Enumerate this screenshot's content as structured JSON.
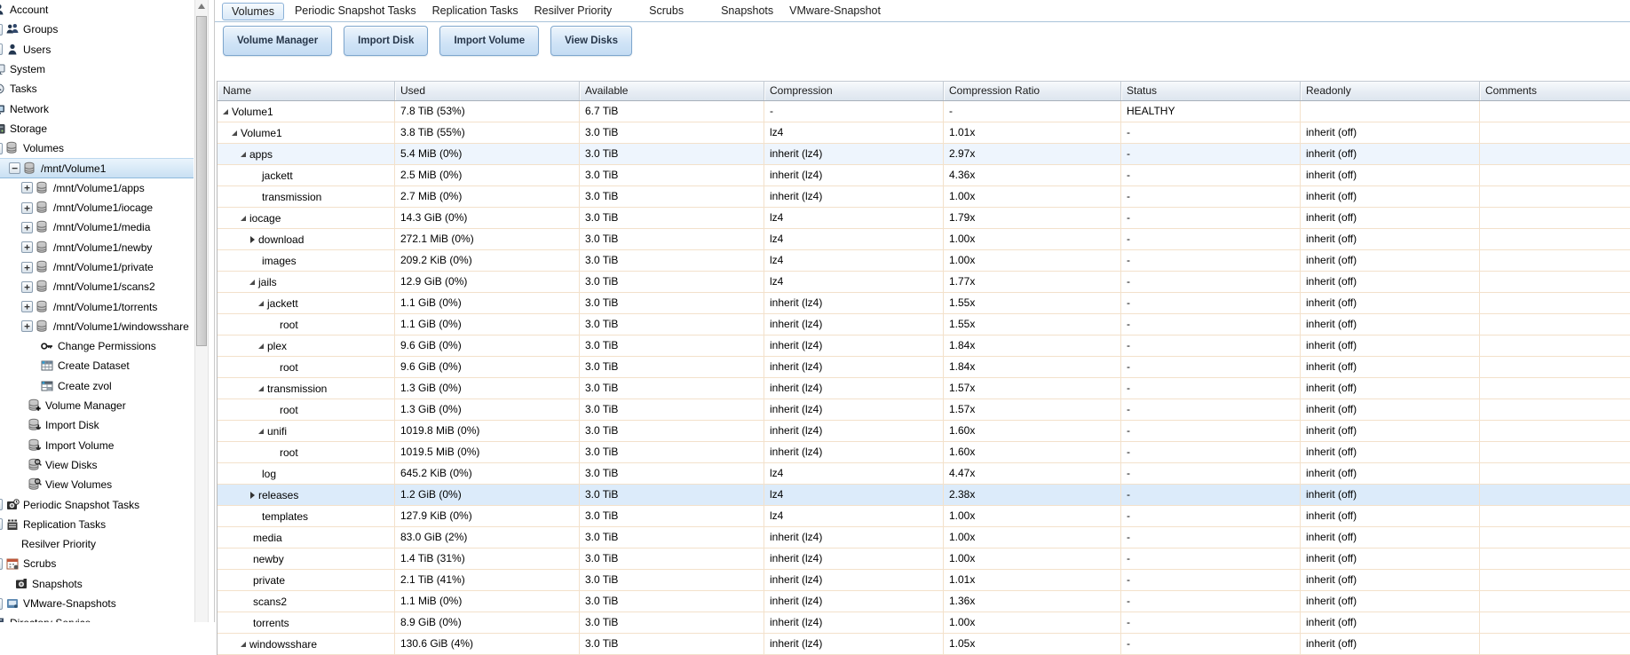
{
  "colors": {
    "selection_blue": "#dcebfa",
    "hover_blue": "#eef5fd",
    "row_border_tan": "#f3e1cb",
    "button_face": "#cfe3f6",
    "button_border": "#7ea6cd",
    "tab_border": "#8cb2d8",
    "sidebar_selection": "#c9e0f3",
    "healthy_status": "#000000"
  },
  "tabs": {
    "active": "Volumes",
    "items": [
      "Volumes",
      "Periodic Snapshot Tasks",
      "Replication Tasks",
      "Resilver Priority",
      "Scrubs",
      "Snapshots",
      "VMware-Snapshot"
    ]
  },
  "toolbar": {
    "buttons": [
      "Volume Manager",
      "Import Disk",
      "Import Volume",
      "View Disks"
    ]
  },
  "sidebar": {
    "items": [
      {
        "label": "Account",
        "icon": "account-icon",
        "pad": 0,
        "exp": "none",
        "cut_icon": true
      },
      {
        "label": "Groups",
        "icon": "groups-icon",
        "pad": 0,
        "exp": "cut"
      },
      {
        "label": "Users",
        "icon": "user-icon",
        "pad": 0,
        "exp": "cut"
      },
      {
        "label": "System",
        "icon": "system-icon",
        "pad": 0,
        "exp": "none",
        "cut_icon": true
      },
      {
        "label": "Tasks",
        "icon": "tasks-icon",
        "pad": 0,
        "exp": "none",
        "cut_icon": true
      },
      {
        "label": "Network",
        "icon": "network-icon",
        "pad": 0,
        "exp": "none",
        "cut_icon": true
      },
      {
        "label": "Storage",
        "icon": "storage-icon",
        "pad": 0,
        "exp": "none",
        "cut_icon": true
      },
      {
        "label": "Volumes",
        "icon": "volume-icon",
        "pad": 0,
        "exp": "cut"
      },
      {
        "label": "/mnt/Volume1",
        "icon": "volume-icon",
        "pad": 10,
        "exp": "minus",
        "selected": true
      },
      {
        "label": "/mnt/Volume1/apps",
        "icon": "volume-icon",
        "pad": 24,
        "exp": "plus"
      },
      {
        "label": "/mnt/Volume1/iocage",
        "icon": "volume-icon",
        "pad": 24,
        "exp": "plus"
      },
      {
        "label": "/mnt/Volume1/media",
        "icon": "volume-icon",
        "pad": 24,
        "exp": "plus"
      },
      {
        "label": "/mnt/Volume1/newby",
        "icon": "volume-icon",
        "pad": 24,
        "exp": "plus"
      },
      {
        "label": "/mnt/Volume1/private",
        "icon": "volume-icon",
        "pad": 24,
        "exp": "plus"
      },
      {
        "label": "/mnt/Volume1/scans2",
        "icon": "volume-icon",
        "pad": 24,
        "exp": "plus"
      },
      {
        "label": "/mnt/Volume1/torrents",
        "icon": "volume-icon",
        "pad": 24,
        "exp": "plus"
      },
      {
        "label": "/mnt/Volume1/windowsshare",
        "icon": "volume-icon",
        "pad": 24,
        "exp": "plus"
      },
      {
        "label": "Change Permissions",
        "icon": "key-icon",
        "pad": 42,
        "exp": "none"
      },
      {
        "label": "Create Dataset",
        "icon": "dataset-icon",
        "pad": 42,
        "exp": "none"
      },
      {
        "label": "Create zvol",
        "icon": "zvol-icon",
        "pad": 42,
        "exp": "none"
      },
      {
        "label": "Volume Manager",
        "icon": "volume-manager-icon",
        "pad": 28,
        "exp": "none"
      },
      {
        "label": "Import Disk",
        "icon": "import-disk-icon",
        "pad": 28,
        "exp": "none"
      },
      {
        "label": "Import Volume",
        "icon": "import-volume-icon",
        "pad": 28,
        "exp": "none"
      },
      {
        "label": "View Disks",
        "icon": "view-disks-icon",
        "pad": 28,
        "exp": "none"
      },
      {
        "label": "View Volumes",
        "icon": "view-volumes-icon",
        "pad": 28,
        "exp": "none"
      },
      {
        "label": "Periodic Snapshot Tasks",
        "icon": "snapshot-task-icon",
        "pad": 0,
        "exp": "cut"
      },
      {
        "label": "Replication Tasks",
        "icon": "replication-icon",
        "pad": 0,
        "exp": "cut"
      },
      {
        "label": "Resilver Priority",
        "icon": null,
        "pad": 20,
        "exp": "none"
      },
      {
        "label": "Scrubs",
        "icon": "scrub-icon",
        "pad": 0,
        "exp": "cut"
      },
      {
        "label": "Snapshots",
        "icon": "snapshot-icon",
        "pad": 13,
        "exp": "none"
      },
      {
        "label": "VMware-Snapshots",
        "icon": "vmware-snapshot-icon",
        "pad": 0,
        "exp": "cut"
      },
      {
        "label": "Directory Service",
        "icon": "directory-icon",
        "pad": 0,
        "exp": "none",
        "cut_icon": true
      }
    ]
  },
  "table": {
    "columns": [
      "Name",
      "Used",
      "Available",
      "Compression",
      "Compression Ratio",
      "Status",
      "Readonly",
      "Comments"
    ],
    "rows": [
      {
        "name": "Volume1",
        "level": 0,
        "exp": "down",
        "used": "7.8 TiB (53%)",
        "available": "6.7 TiB",
        "compression": "-",
        "ratio": "-",
        "status": "HEALTHY",
        "readonly": "",
        "comments": "",
        "highlight": ""
      },
      {
        "name": "Volume1",
        "level": 1,
        "exp": "down",
        "used": "3.8 TiB (55%)",
        "available": "3.0 TiB",
        "compression": "lz4",
        "ratio": "1.01x",
        "status": "-",
        "readonly": "inherit (off)",
        "comments": "",
        "highlight": ""
      },
      {
        "name": "apps",
        "level": 2,
        "exp": "down",
        "used": "5.4 MiB (0%)",
        "available": "3.0 TiB",
        "compression": "inherit (lz4)",
        "ratio": "2.97x",
        "status": "-",
        "readonly": "inherit (off)",
        "comments": "",
        "highlight": "hl1"
      },
      {
        "name": "jackett",
        "level": 3,
        "exp": "none",
        "used": "2.5 MiB (0%)",
        "available": "3.0 TiB",
        "compression": "inherit (lz4)",
        "ratio": "4.36x",
        "status": "-",
        "readonly": "inherit (off)",
        "comments": "",
        "highlight": ""
      },
      {
        "name": "transmission",
        "level": 3,
        "exp": "none",
        "used": "2.7 MiB (0%)",
        "available": "3.0 TiB",
        "compression": "inherit (lz4)",
        "ratio": "1.00x",
        "status": "-",
        "readonly": "inherit (off)",
        "comments": "",
        "highlight": ""
      },
      {
        "name": "iocage",
        "level": 2,
        "exp": "down",
        "used": "14.3 GiB (0%)",
        "available": "3.0 TiB",
        "compression": "lz4",
        "ratio": "1.79x",
        "status": "-",
        "readonly": "inherit (off)",
        "comments": "",
        "highlight": ""
      },
      {
        "name": "download",
        "level": 3,
        "exp": "right",
        "used": "272.1 MiB (0%)",
        "available": "3.0 TiB",
        "compression": "lz4",
        "ratio": "1.00x",
        "status": "-",
        "readonly": "inherit (off)",
        "comments": "",
        "highlight": ""
      },
      {
        "name": "images",
        "level": 3,
        "exp": "none",
        "used": "209.2 KiB (0%)",
        "available": "3.0 TiB",
        "compression": "lz4",
        "ratio": "1.00x",
        "status": "-",
        "readonly": "inherit (off)",
        "comments": "",
        "highlight": ""
      },
      {
        "name": "jails",
        "level": 3,
        "exp": "down",
        "used": "12.9 GiB (0%)",
        "available": "3.0 TiB",
        "compression": "lz4",
        "ratio": "1.77x",
        "status": "-",
        "readonly": "inherit (off)",
        "comments": "",
        "highlight": ""
      },
      {
        "name": "jackett",
        "level": 4,
        "exp": "down",
        "used": "1.1 GiB (0%)",
        "available": "3.0 TiB",
        "compression": "inherit (lz4)",
        "ratio": "1.55x",
        "status": "-",
        "readonly": "inherit (off)",
        "comments": "",
        "highlight": ""
      },
      {
        "name": "root",
        "level": 5,
        "exp": "none",
        "used": "1.1 GiB (0%)",
        "available": "3.0 TiB",
        "compression": "inherit (lz4)",
        "ratio": "1.55x",
        "status": "-",
        "readonly": "inherit (off)",
        "comments": "",
        "highlight": ""
      },
      {
        "name": "plex",
        "level": 4,
        "exp": "down",
        "used": "9.6 GiB (0%)",
        "available": "3.0 TiB",
        "compression": "inherit (lz4)",
        "ratio": "1.84x",
        "status": "-",
        "readonly": "inherit (off)",
        "comments": "",
        "highlight": ""
      },
      {
        "name": "root",
        "level": 5,
        "exp": "none",
        "used": "9.6 GiB (0%)",
        "available": "3.0 TiB",
        "compression": "inherit (lz4)",
        "ratio": "1.84x",
        "status": "-",
        "readonly": "inherit (off)",
        "comments": "",
        "highlight": ""
      },
      {
        "name": "transmission",
        "level": 4,
        "exp": "down",
        "used": "1.3 GiB (0%)",
        "available": "3.0 TiB",
        "compression": "inherit (lz4)",
        "ratio": "1.57x",
        "status": "-",
        "readonly": "inherit (off)",
        "comments": "",
        "highlight": ""
      },
      {
        "name": "root",
        "level": 5,
        "exp": "none",
        "used": "1.3 GiB (0%)",
        "available": "3.0 TiB",
        "compression": "inherit (lz4)",
        "ratio": "1.57x",
        "status": "-",
        "readonly": "inherit (off)",
        "comments": "",
        "highlight": ""
      },
      {
        "name": "unifi",
        "level": 4,
        "exp": "down",
        "used": "1019.8 MiB (0%)",
        "available": "3.0 TiB",
        "compression": "inherit (lz4)",
        "ratio": "1.60x",
        "status": "-",
        "readonly": "inherit (off)",
        "comments": "",
        "highlight": ""
      },
      {
        "name": "root",
        "level": 5,
        "exp": "none",
        "used": "1019.5 MiB (0%)",
        "available": "3.0 TiB",
        "compression": "inherit (lz4)",
        "ratio": "1.60x",
        "status": "-",
        "readonly": "inherit (off)",
        "comments": "",
        "highlight": ""
      },
      {
        "name": "log",
        "level": 3,
        "exp": "none",
        "used": "645.2 KiB (0%)",
        "available": "3.0 TiB",
        "compression": "lz4",
        "ratio": "4.47x",
        "status": "-",
        "readonly": "inherit (off)",
        "comments": "",
        "highlight": ""
      },
      {
        "name": "releases",
        "level": 3,
        "exp": "right",
        "used": "1.2 GiB (0%)",
        "available": "3.0 TiB",
        "compression": "lz4",
        "ratio": "2.38x",
        "status": "-",
        "readonly": "inherit (off)",
        "comments": "",
        "highlight": "hl2"
      },
      {
        "name": "templates",
        "level": 3,
        "exp": "none",
        "used": "127.9 KiB (0%)",
        "available": "3.0 TiB",
        "compression": "lz4",
        "ratio": "1.00x",
        "status": "-",
        "readonly": "inherit (off)",
        "comments": "",
        "highlight": ""
      },
      {
        "name": "media",
        "level": 2,
        "exp": "none",
        "used": "83.0 GiB (2%)",
        "available": "3.0 TiB",
        "compression": "inherit (lz4)",
        "ratio": "1.00x",
        "status": "-",
        "readonly": "inherit (off)",
        "comments": "",
        "highlight": ""
      },
      {
        "name": "newby",
        "level": 2,
        "exp": "none",
        "used": "1.4 TiB (31%)",
        "available": "3.0 TiB",
        "compression": "inherit (lz4)",
        "ratio": "1.00x",
        "status": "-",
        "readonly": "inherit (off)",
        "comments": "",
        "highlight": ""
      },
      {
        "name": "private",
        "level": 2,
        "exp": "none",
        "used": "2.1 TiB (41%)",
        "available": "3.0 TiB",
        "compression": "inherit (lz4)",
        "ratio": "1.01x",
        "status": "-",
        "readonly": "inherit (off)",
        "comments": "",
        "highlight": ""
      },
      {
        "name": "scans2",
        "level": 2,
        "exp": "none",
        "used": "1.1 MiB (0%)",
        "available": "3.0 TiB",
        "compression": "inherit (lz4)",
        "ratio": "1.36x",
        "status": "-",
        "readonly": "inherit (off)",
        "comments": "",
        "highlight": ""
      },
      {
        "name": "torrents",
        "level": 2,
        "exp": "none",
        "used": "8.9 GiB (0%)",
        "available": "3.0 TiB",
        "compression": "inherit (lz4)",
        "ratio": "1.00x",
        "status": "-",
        "readonly": "inherit (off)",
        "comments": "",
        "highlight": ""
      },
      {
        "name": "windowsshare",
        "level": 2,
        "exp": "down",
        "used": "130.6 GiB (4%)",
        "available": "3.0 TiB",
        "compression": "inherit (lz4)",
        "ratio": "1.05x",
        "status": "-",
        "readonly": "inherit (off)",
        "comments": "",
        "highlight": ""
      }
    ]
  }
}
